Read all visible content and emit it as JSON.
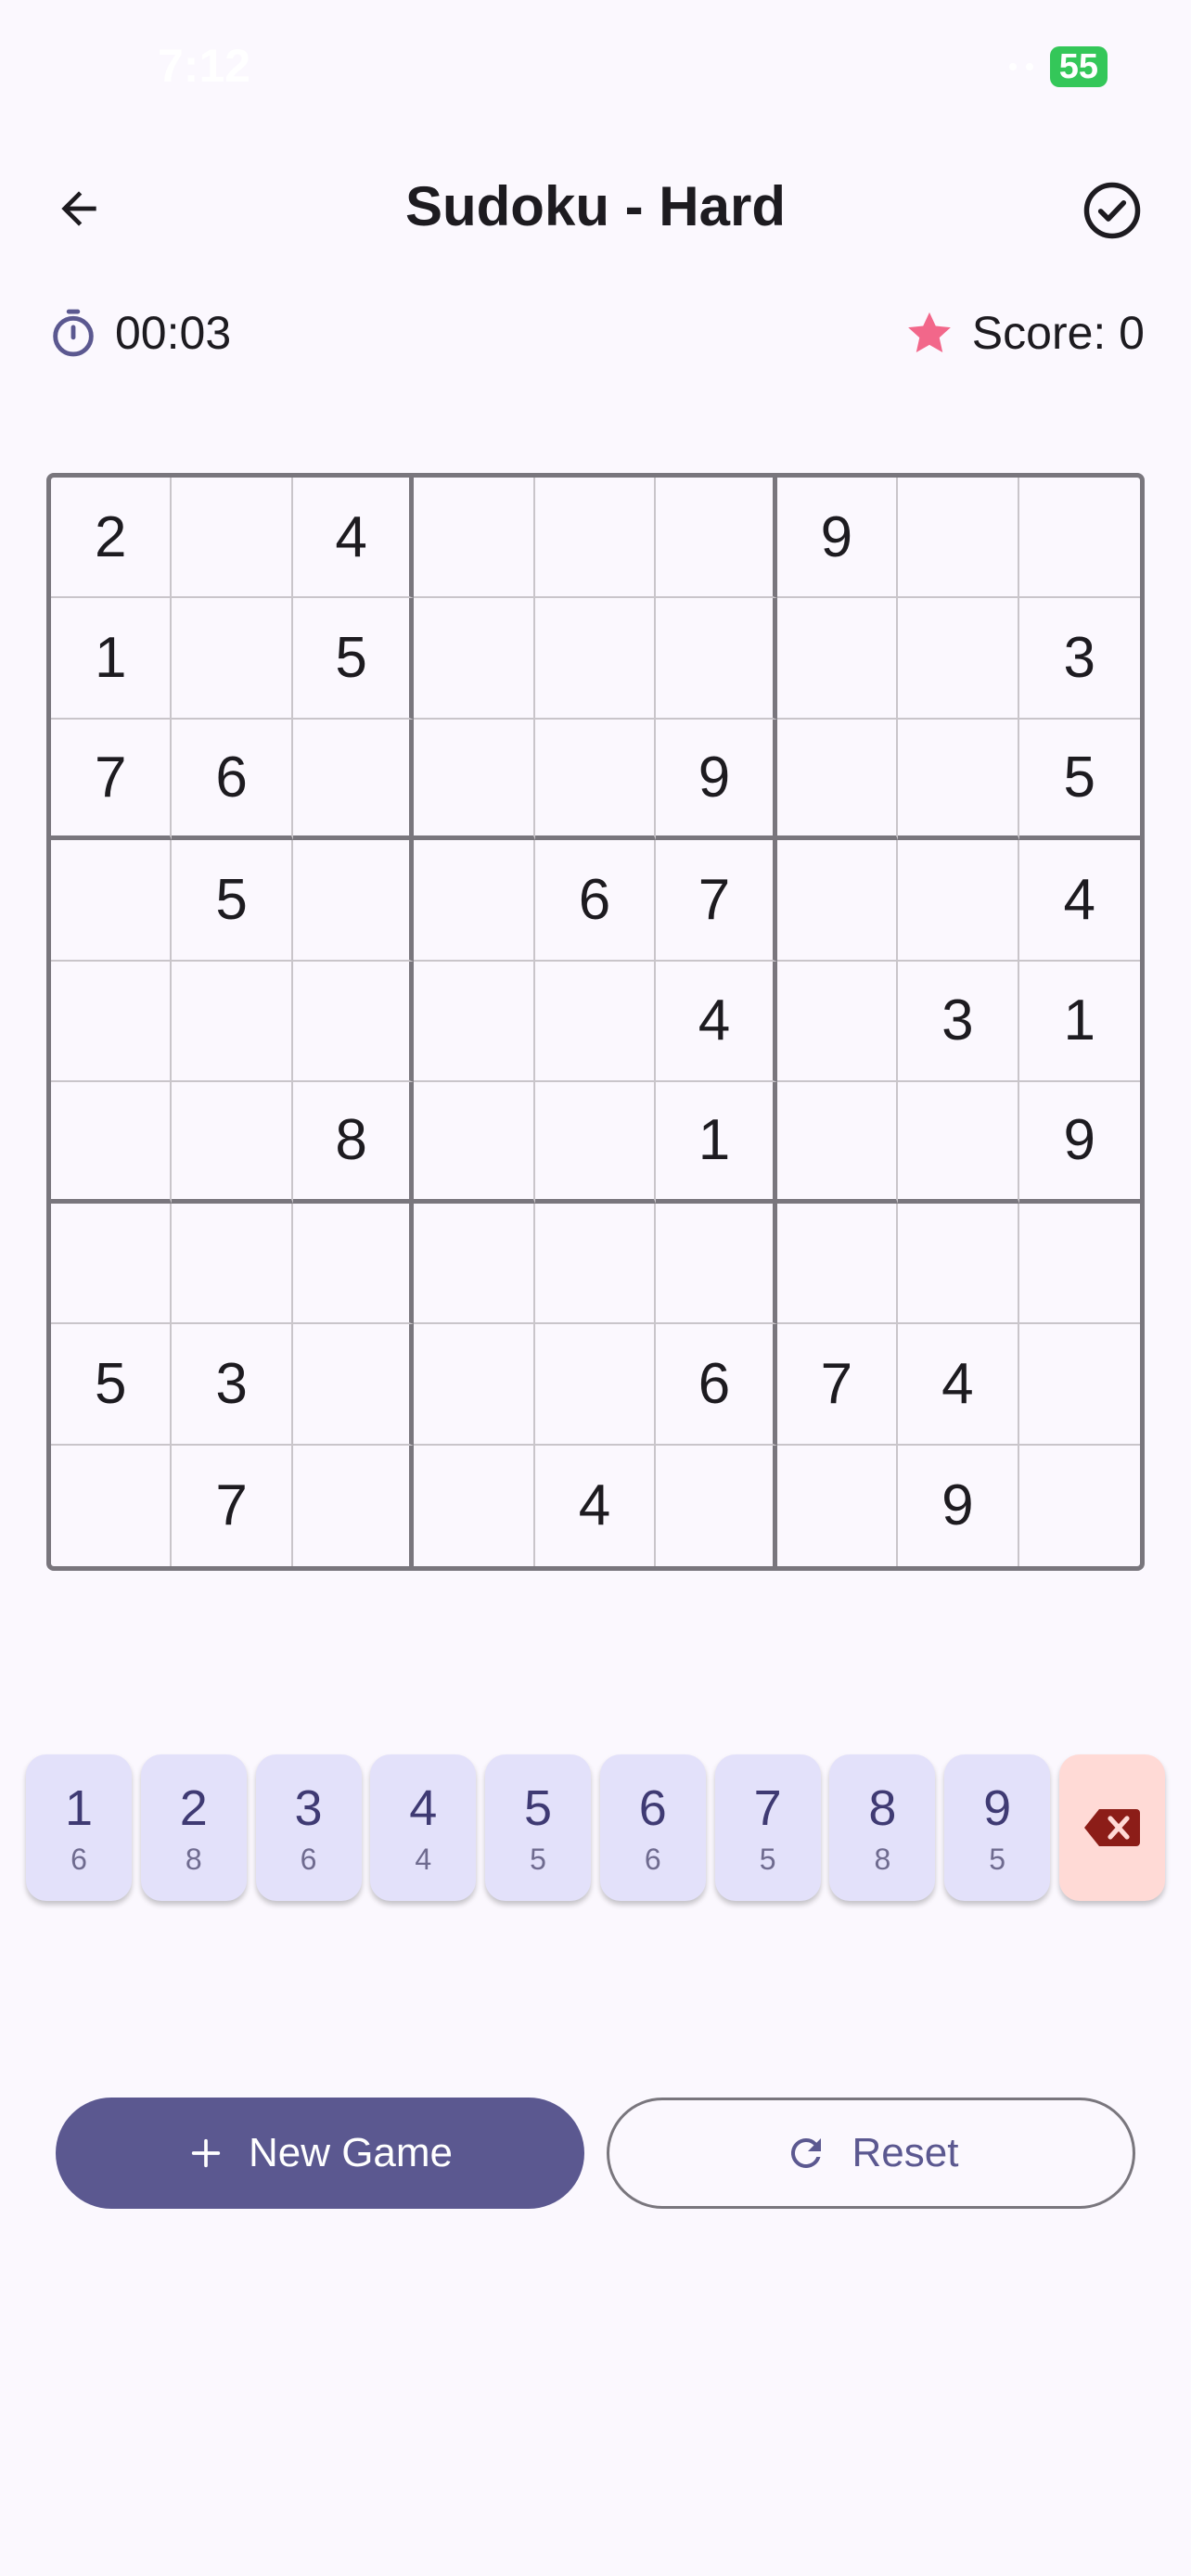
{
  "status": {
    "time": "7:12",
    "battery": "55"
  },
  "app_bar": {
    "title": "Sudoku - Hard"
  },
  "info": {
    "timer": "00:03",
    "score": "Score: 0"
  },
  "board": [
    [
      "2",
      "",
      "4",
      "",
      "",
      "",
      "9",
      "",
      ""
    ],
    [
      "1",
      "",
      "5",
      "",
      "",
      "",
      "",
      "",
      "3"
    ],
    [
      "7",
      "6",
      "",
      "",
      "",
      "9",
      "",
      "",
      "5"
    ],
    [
      "",
      "5",
      "",
      "",
      "6",
      "7",
      "",
      "",
      "4"
    ],
    [
      "",
      "",
      "",
      "",
      "",
      "4",
      "",
      "3",
      "1"
    ],
    [
      "",
      "",
      "8",
      "",
      "",
      "1",
      "",
      "",
      "9"
    ],
    [
      "",
      "",
      "",
      "",
      "",
      "",
      "",
      "",
      ""
    ],
    [
      "5",
      "3",
      "",
      "",
      "",
      "6",
      "7",
      "4",
      ""
    ],
    [
      "",
      "7",
      "",
      "",
      "4",
      "",
      "",
      "9",
      ""
    ]
  ],
  "numpad": {
    "keys": [
      {
        "digit": "1",
        "count": "6"
      },
      {
        "digit": "2",
        "count": "8"
      },
      {
        "digit": "3",
        "count": "6"
      },
      {
        "digit": "4",
        "count": "4"
      },
      {
        "digit": "5",
        "count": "5"
      },
      {
        "digit": "6",
        "count": "6"
      },
      {
        "digit": "7",
        "count": "5"
      },
      {
        "digit": "8",
        "count": "8"
      },
      {
        "digit": "9",
        "count": "5"
      }
    ],
    "erase_icon": "backspace-icon"
  },
  "actions": {
    "new_game_label": "New Game",
    "reset_label": "Reset"
  },
  "colors": {
    "primary": "#5b5890",
    "star": "#f2678a",
    "erase_bg": "#ffdad6",
    "erase_icon": "#8c1d18",
    "key_bg": "#e3e1fa"
  }
}
